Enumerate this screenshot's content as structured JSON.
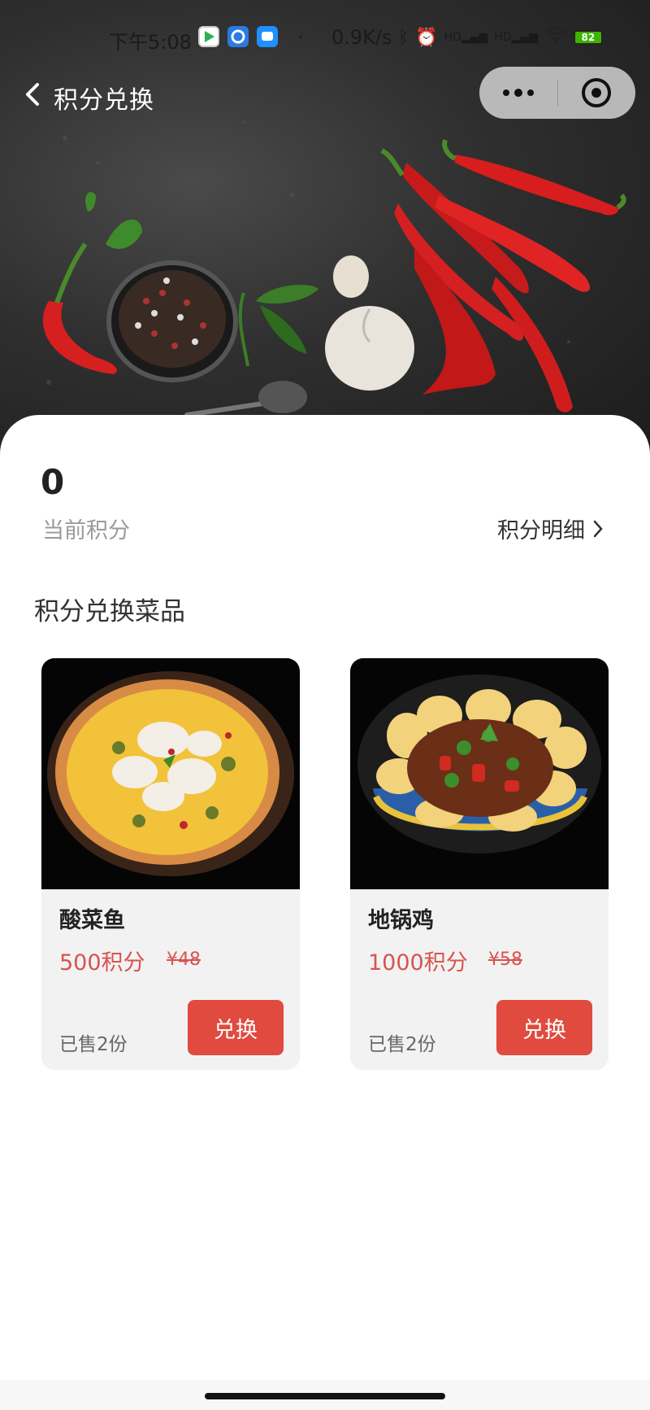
{
  "status_bar": {
    "time": "下午5:08",
    "dot": "·",
    "net_speed": "0.9K/s",
    "signal1": "HD",
    "signal2": "HD",
    "battery": "82"
  },
  "nav": {
    "title": "积分兑换",
    "back_icon": "back-chevron-icon",
    "more_icon": "more-dots-icon",
    "close_icon": "target-close-icon"
  },
  "points": {
    "value": "0",
    "label": "当前积分",
    "detail_link": "积分明细"
  },
  "section_title": "积分兑换菜品",
  "dishes": [
    {
      "name": "酸菜鱼",
      "points": "500积分",
      "currency": "¥",
      "original_price": "48",
      "sold": "已售2份",
      "button": "兑换"
    },
    {
      "name": "地锅鸡",
      "points": "1000积分",
      "currency": "¥",
      "original_price": "58",
      "sold": "已售2份",
      "button": "兑换"
    }
  ],
  "colors": {
    "accent": "#e04a3f",
    "price": "#d9534f",
    "card_bg": "#f2f2f2"
  }
}
